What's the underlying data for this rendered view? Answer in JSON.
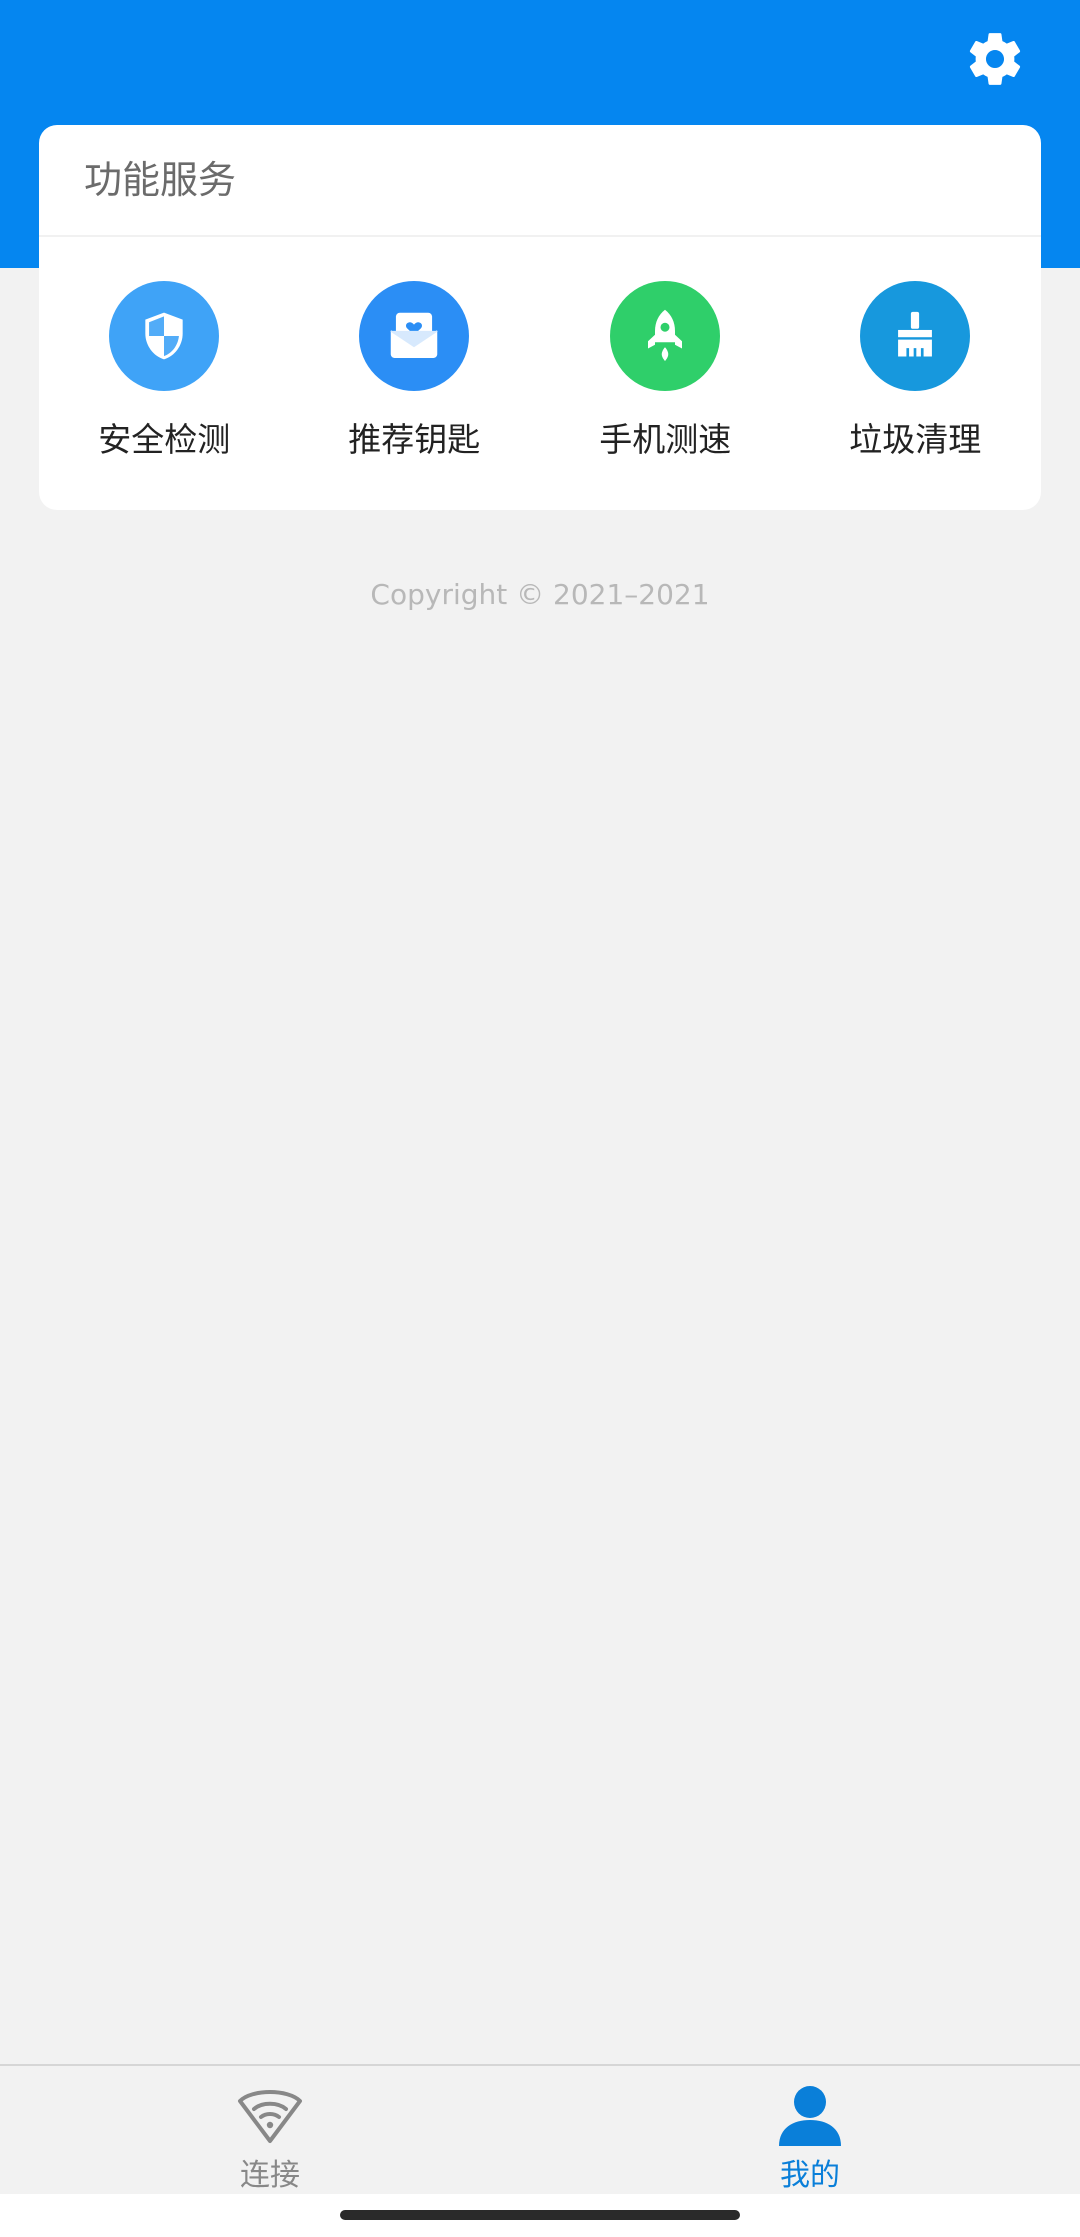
{
  "header": {
    "background_color": "#0586f0",
    "settings_icon": "gear-icon"
  },
  "services_card": {
    "title": "功能服务",
    "items": [
      {
        "label": "安全检测",
        "icon": "shield-icon",
        "color": "#3fa3f7"
      },
      {
        "label": "推荐钥匙",
        "icon": "mail-heart-icon",
        "color": "#2b8ef5"
      },
      {
        "label": "手机测速",
        "icon": "rocket-icon",
        "color": "#2fcf6a"
      },
      {
        "label": "垃圾清理",
        "icon": "broom-icon",
        "color": "#1798dd"
      }
    ]
  },
  "footer": {
    "copyright": "Copyright © 2021–2021"
  },
  "tabbar": {
    "tabs": [
      {
        "label": "连接",
        "icon": "wifi-icon",
        "active": false,
        "color": "#888888"
      },
      {
        "label": "我的",
        "icon": "user-icon",
        "active": true,
        "color": "#0a7fd9"
      }
    ]
  }
}
